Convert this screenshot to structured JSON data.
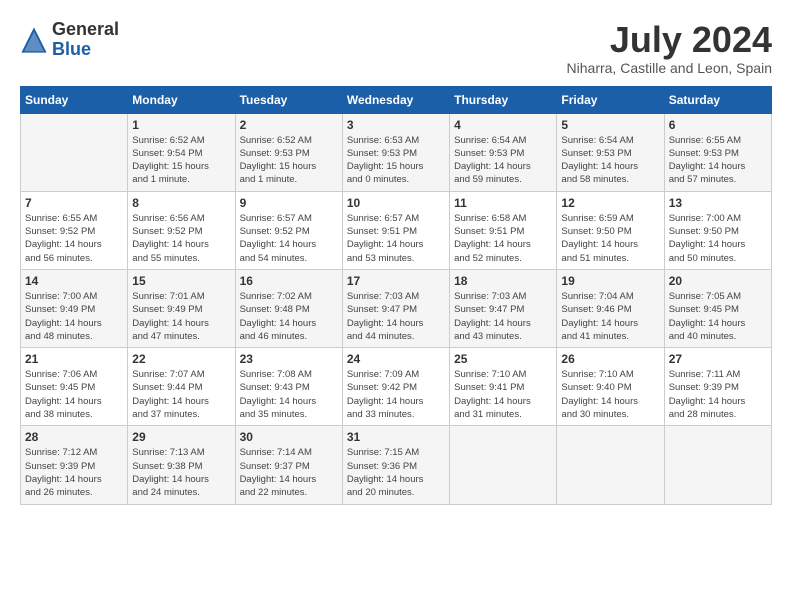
{
  "header": {
    "logo_general": "General",
    "logo_blue": "Blue",
    "month_title": "July 2024",
    "location": "Niharra, Castille and Leon, Spain"
  },
  "calendar": {
    "days_of_week": [
      "Sunday",
      "Monday",
      "Tuesday",
      "Wednesday",
      "Thursday",
      "Friday",
      "Saturday"
    ],
    "weeks": [
      [
        {
          "day": "",
          "info": ""
        },
        {
          "day": "1",
          "info": "Sunrise: 6:52 AM\nSunset: 9:54 PM\nDaylight: 15 hours\nand 1 minute."
        },
        {
          "day": "2",
          "info": "Sunrise: 6:52 AM\nSunset: 9:53 PM\nDaylight: 15 hours\nand 1 minute."
        },
        {
          "day": "3",
          "info": "Sunrise: 6:53 AM\nSunset: 9:53 PM\nDaylight: 15 hours\nand 0 minutes."
        },
        {
          "day": "4",
          "info": "Sunrise: 6:54 AM\nSunset: 9:53 PM\nDaylight: 14 hours\nand 59 minutes."
        },
        {
          "day": "5",
          "info": "Sunrise: 6:54 AM\nSunset: 9:53 PM\nDaylight: 14 hours\nand 58 minutes."
        },
        {
          "day": "6",
          "info": "Sunrise: 6:55 AM\nSunset: 9:53 PM\nDaylight: 14 hours\nand 57 minutes."
        }
      ],
      [
        {
          "day": "7",
          "info": "Sunrise: 6:55 AM\nSunset: 9:52 PM\nDaylight: 14 hours\nand 56 minutes."
        },
        {
          "day": "8",
          "info": "Sunrise: 6:56 AM\nSunset: 9:52 PM\nDaylight: 14 hours\nand 55 minutes."
        },
        {
          "day": "9",
          "info": "Sunrise: 6:57 AM\nSunset: 9:52 PM\nDaylight: 14 hours\nand 54 minutes."
        },
        {
          "day": "10",
          "info": "Sunrise: 6:57 AM\nSunset: 9:51 PM\nDaylight: 14 hours\nand 53 minutes."
        },
        {
          "day": "11",
          "info": "Sunrise: 6:58 AM\nSunset: 9:51 PM\nDaylight: 14 hours\nand 52 minutes."
        },
        {
          "day": "12",
          "info": "Sunrise: 6:59 AM\nSunset: 9:50 PM\nDaylight: 14 hours\nand 51 minutes."
        },
        {
          "day": "13",
          "info": "Sunrise: 7:00 AM\nSunset: 9:50 PM\nDaylight: 14 hours\nand 50 minutes."
        }
      ],
      [
        {
          "day": "14",
          "info": "Sunrise: 7:00 AM\nSunset: 9:49 PM\nDaylight: 14 hours\nand 48 minutes."
        },
        {
          "day": "15",
          "info": "Sunrise: 7:01 AM\nSunset: 9:49 PM\nDaylight: 14 hours\nand 47 minutes."
        },
        {
          "day": "16",
          "info": "Sunrise: 7:02 AM\nSunset: 9:48 PM\nDaylight: 14 hours\nand 46 minutes."
        },
        {
          "day": "17",
          "info": "Sunrise: 7:03 AM\nSunset: 9:47 PM\nDaylight: 14 hours\nand 44 minutes."
        },
        {
          "day": "18",
          "info": "Sunrise: 7:03 AM\nSunset: 9:47 PM\nDaylight: 14 hours\nand 43 minutes."
        },
        {
          "day": "19",
          "info": "Sunrise: 7:04 AM\nSunset: 9:46 PM\nDaylight: 14 hours\nand 41 minutes."
        },
        {
          "day": "20",
          "info": "Sunrise: 7:05 AM\nSunset: 9:45 PM\nDaylight: 14 hours\nand 40 minutes."
        }
      ],
      [
        {
          "day": "21",
          "info": "Sunrise: 7:06 AM\nSunset: 9:45 PM\nDaylight: 14 hours\nand 38 minutes."
        },
        {
          "day": "22",
          "info": "Sunrise: 7:07 AM\nSunset: 9:44 PM\nDaylight: 14 hours\nand 37 minutes."
        },
        {
          "day": "23",
          "info": "Sunrise: 7:08 AM\nSunset: 9:43 PM\nDaylight: 14 hours\nand 35 minutes."
        },
        {
          "day": "24",
          "info": "Sunrise: 7:09 AM\nSunset: 9:42 PM\nDaylight: 14 hours\nand 33 minutes."
        },
        {
          "day": "25",
          "info": "Sunrise: 7:10 AM\nSunset: 9:41 PM\nDaylight: 14 hours\nand 31 minutes."
        },
        {
          "day": "26",
          "info": "Sunrise: 7:10 AM\nSunset: 9:40 PM\nDaylight: 14 hours\nand 30 minutes."
        },
        {
          "day": "27",
          "info": "Sunrise: 7:11 AM\nSunset: 9:39 PM\nDaylight: 14 hours\nand 28 minutes."
        }
      ],
      [
        {
          "day": "28",
          "info": "Sunrise: 7:12 AM\nSunset: 9:39 PM\nDaylight: 14 hours\nand 26 minutes."
        },
        {
          "day": "29",
          "info": "Sunrise: 7:13 AM\nSunset: 9:38 PM\nDaylight: 14 hours\nand 24 minutes."
        },
        {
          "day": "30",
          "info": "Sunrise: 7:14 AM\nSunset: 9:37 PM\nDaylight: 14 hours\nand 22 minutes."
        },
        {
          "day": "31",
          "info": "Sunrise: 7:15 AM\nSunset: 9:36 PM\nDaylight: 14 hours\nand 20 minutes."
        },
        {
          "day": "",
          "info": ""
        },
        {
          "day": "",
          "info": ""
        },
        {
          "day": "",
          "info": ""
        }
      ]
    ]
  }
}
